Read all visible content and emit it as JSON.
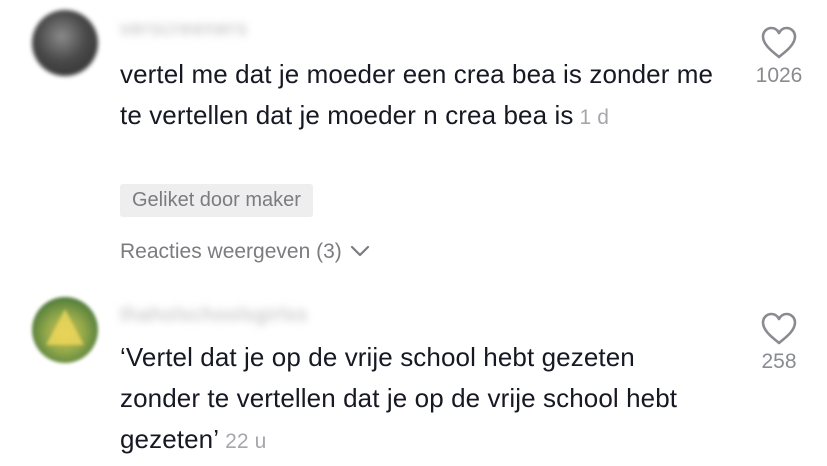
{
  "comments": [
    {
      "username": "verscreeners",
      "text": "vertel me dat je moeder een crea bea is zonder me te vertellen dat je moeder n crea bea is",
      "time": "1 d",
      "badge": "Geliket door maker",
      "replies_label": "Reacties weergeven (3)",
      "likes": "1026",
      "avatar_icon": "avatar-dark"
    },
    {
      "username": "thaholschoolsgirlss",
      "text": "‘Vertel dat je op de vrije school hebt gezeten zonder te vertellen dat je op de vrije school hebt gezeten’",
      "time": "22 u",
      "likes": "258",
      "avatar_icon": "avatar-green-triangle"
    }
  ],
  "icons": {
    "like": "heart-outline-icon",
    "expand": "chevron-down-icon"
  },
  "colors": {
    "text": "#161823",
    "muted": "#7c7c80",
    "timestamp": "#a7a7ab",
    "badge_bg": "#eeeeef",
    "like_count": "#8a8b91"
  }
}
